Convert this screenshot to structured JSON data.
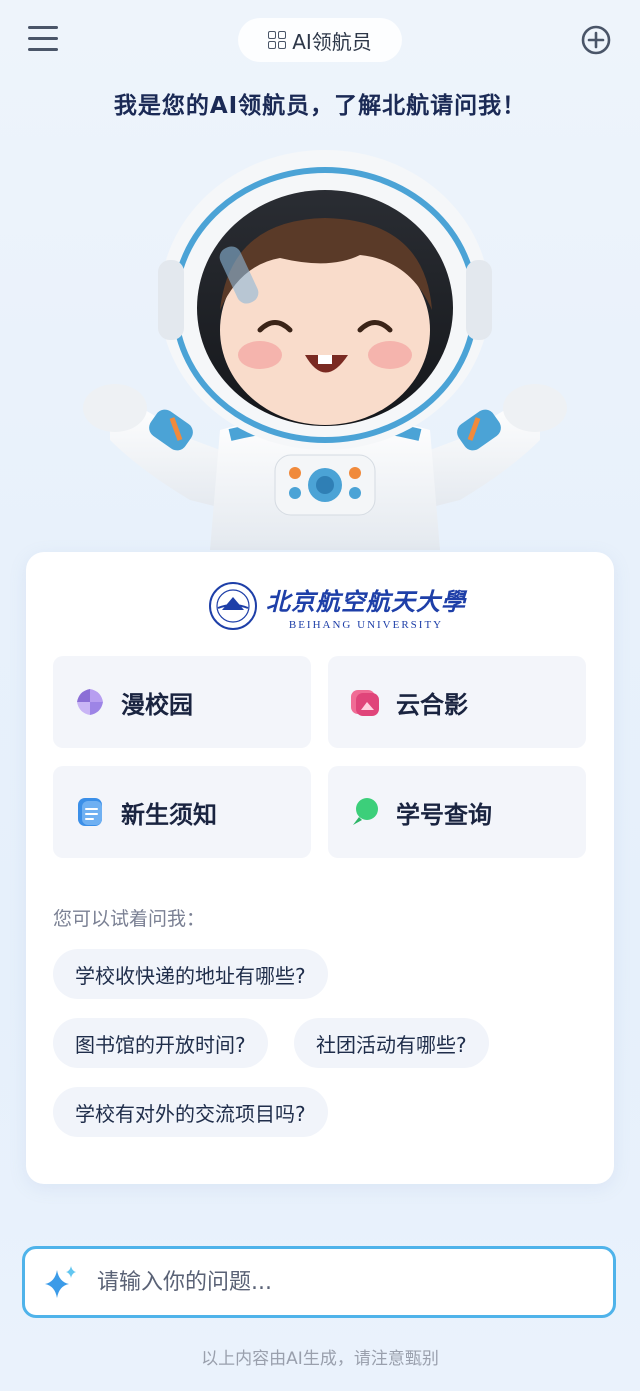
{
  "header": {
    "title": "AI领航员",
    "menu_icon": "menu-icon",
    "new_chat_icon": "plus-circle-icon"
  },
  "headline": "我是您的AI领航员，了解北航请问我！",
  "mascot_icon": "astronaut-mascot",
  "logo": {
    "cn": "北京航空航天大學",
    "en": "BEIHANG UNIVERSITY"
  },
  "tiles": [
    {
      "label": "漫校园",
      "icon": "campus-icon",
      "color": "#8b6fd6"
    },
    {
      "label": "云合影",
      "icon": "photo-icon",
      "color": "#e0457a"
    },
    {
      "label": "新生须知",
      "icon": "notice-icon",
      "color": "#3b8fe8"
    },
    {
      "label": "学号查询",
      "icon": "search-bubble-icon",
      "color": "#3ccf7a"
    }
  ],
  "suggestions": {
    "hint": "您可以试着问我：",
    "items": [
      "学校收快递的地址有哪些?",
      "图书馆的开放时间?",
      "社团活动有哪些?",
      "学校有对外的交流项目吗?"
    ]
  },
  "input": {
    "placeholder": "请输入你的问题...",
    "value": "",
    "accent": "#4fb3ea"
  },
  "disclaimer": "以上内容由AI生成，请注意甄别"
}
